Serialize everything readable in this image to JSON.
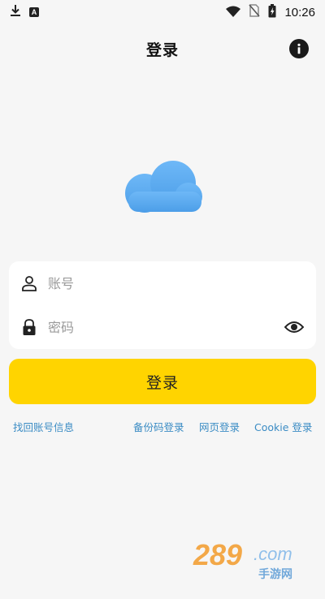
{
  "status_bar": {
    "time": "10:26",
    "icons": [
      "download-icon",
      "app-a-icon",
      "wifi-icon",
      "no-sim-icon",
      "battery-charging-icon"
    ]
  },
  "header": {
    "title": "登录",
    "info_icon": "info-icon"
  },
  "logo": {
    "icon": "cloud-icon",
    "color": "#5aaaf0"
  },
  "form": {
    "account": {
      "placeholder": "账号",
      "value": "",
      "icon": "person-icon"
    },
    "password": {
      "placeholder": "密码",
      "value": "",
      "icon": "lock-icon",
      "toggle_icon": "eye-icon"
    }
  },
  "login_button": {
    "label": "登录",
    "color": "#ffd400"
  },
  "links": {
    "recover": "找回账号信息",
    "backup_code": "备份码登录",
    "web": "网页登录",
    "cookie": "Cookie 登录",
    "color": "#3b8cc4"
  },
  "watermark": {
    "main": "289.com",
    "sub": "手游网"
  }
}
